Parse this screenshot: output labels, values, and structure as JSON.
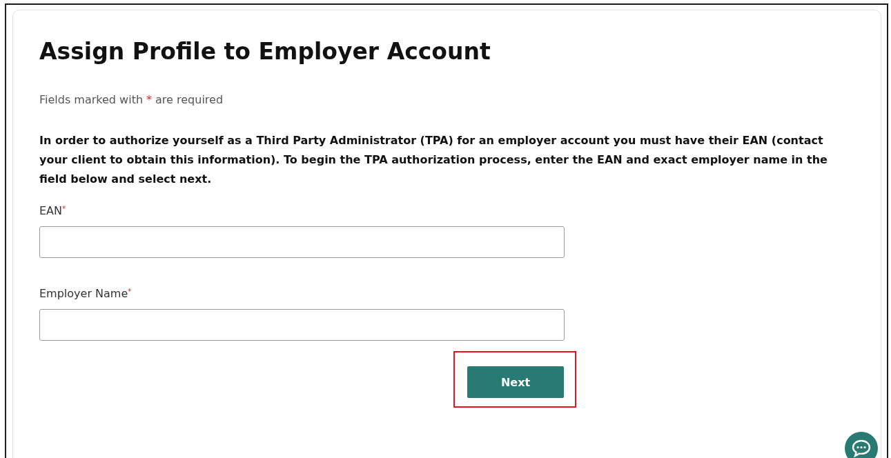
{
  "title": "Assign Profile to Employer Account",
  "required_note": {
    "before": "Fields marked with",
    "mark": "*",
    "after": "are required"
  },
  "instructions": "In order to authorize yourself as a Third Party Administrator (TPA) for an employer account you must have their EAN (contact your client to obtain this information). To begin the TPA authorization process, enter the EAN and exact employer name in the field below and select next.",
  "fields": [
    {
      "label": "EAN",
      "required_mark": "*"
    },
    {
      "label": "Employer Name",
      "required_mark": "*"
    }
  ],
  "next_button": {
    "label": "Next",
    "highlighted": true
  }
}
